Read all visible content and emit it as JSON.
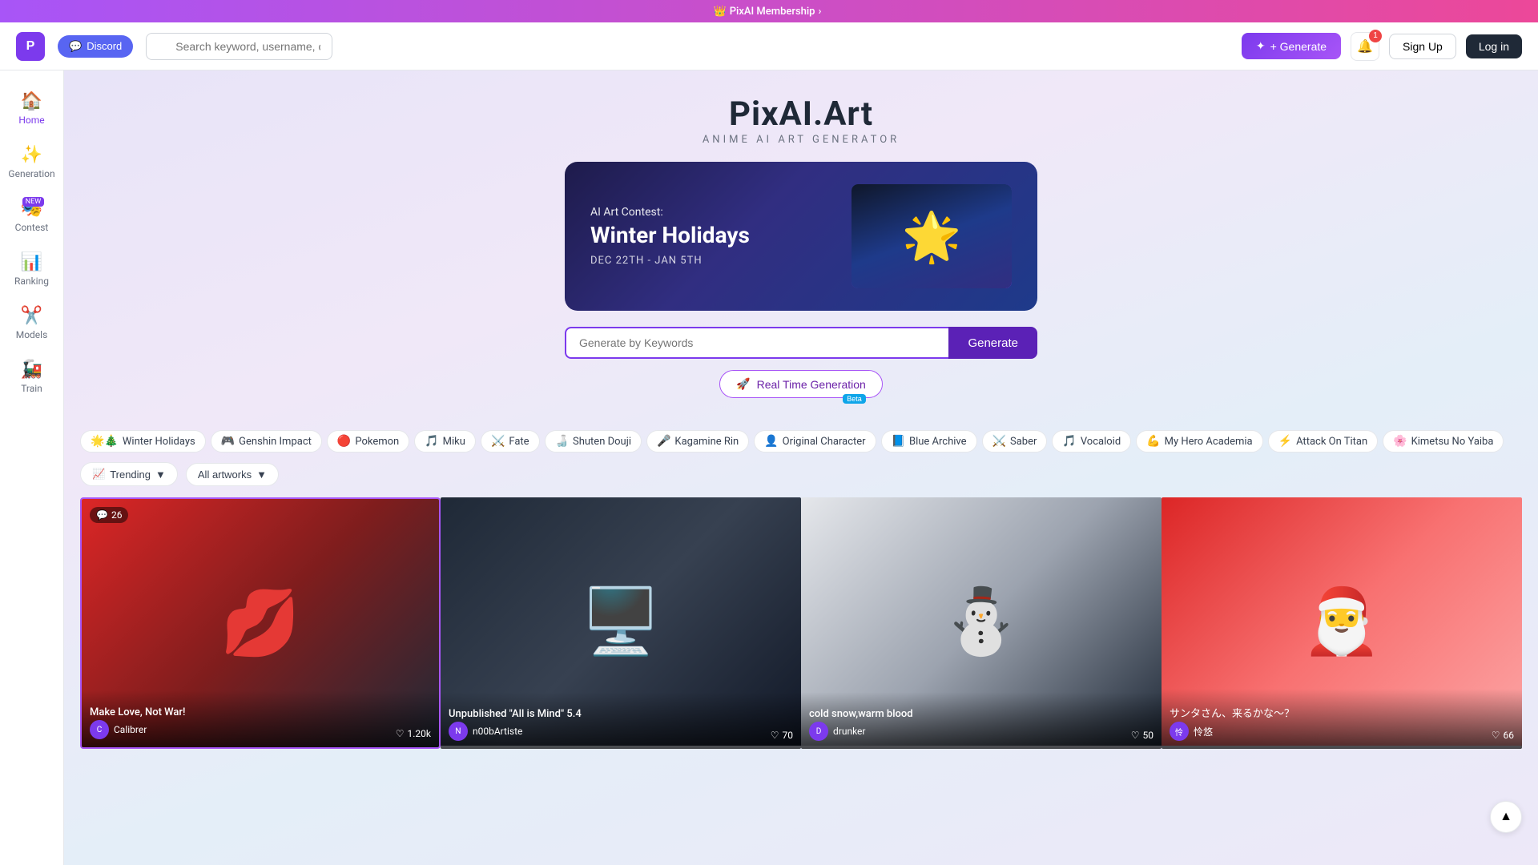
{
  "topBanner": {
    "icon": "👑",
    "text": "PixAI Membership",
    "arrow": "›"
  },
  "header": {
    "logoText": "P",
    "discordLabel": "Discord",
    "discordIcon": "💬",
    "searchPlaceholder": "Search keyword, username, or model name",
    "generateLabel": "+ Generate",
    "notifCount": "1",
    "signUpLabel": "Sign Up",
    "logInLabel": "Log in"
  },
  "sidebar": {
    "items": [
      {
        "id": "home",
        "icon": "🏠",
        "label": "Home",
        "active": true
      },
      {
        "id": "generation",
        "icon": "✨",
        "label": "Generation",
        "active": false
      },
      {
        "id": "contest",
        "icon": "🎭",
        "label": "Contest",
        "active": false,
        "badge": "NEW"
      },
      {
        "id": "ranking",
        "icon": "📊",
        "label": "Ranking",
        "active": false
      },
      {
        "id": "models",
        "icon": "✂️",
        "label": "Models",
        "active": false
      },
      {
        "id": "train",
        "icon": "🚂",
        "label": "Train",
        "active": false
      }
    ]
  },
  "hero": {
    "siteTitle": "PixAI.Art",
    "siteSubtitle": "ANIME AI ART GENERATOR"
  },
  "contestBanner": {
    "label": "AI Art Contest:",
    "title": "Winter Holidays",
    "dateRange": "DEC 22TH - JAN 5TH"
  },
  "generateSection": {
    "placeholder": "Generate by Keywords",
    "buttonLabel": "Generate"
  },
  "realTimeGeneration": {
    "icon": "🚀",
    "label": "Real Time Generation",
    "badge": "Beta"
  },
  "tags": [
    {
      "id": "winter-holidays",
      "emoji": "🌟🎄",
      "label": "Winter Holidays"
    },
    {
      "id": "genshin-impact",
      "emoji": "🎮",
      "label": "Genshin Impact"
    },
    {
      "id": "pokemon",
      "emoji": "🔴",
      "label": "Pokemon"
    },
    {
      "id": "miku",
      "emoji": "🎵",
      "label": "Miku"
    },
    {
      "id": "fate",
      "emoji": "⚔️",
      "label": "Fate"
    },
    {
      "id": "shuten-douji",
      "emoji": "🍶",
      "label": "Shuten Douji"
    },
    {
      "id": "kagamine-rin",
      "emoji": "🎤",
      "label": "Kagamine Rin"
    },
    {
      "id": "original-character",
      "emoji": "👤",
      "label": "Original Character"
    },
    {
      "id": "blue-archive",
      "emoji": "📘",
      "label": "Blue Archive"
    },
    {
      "id": "saber",
      "emoji": "⚔️",
      "label": "Saber"
    },
    {
      "id": "vocaloid",
      "emoji": "🎵",
      "label": "Vocaloid"
    },
    {
      "id": "my-hero-academia",
      "emoji": "💪",
      "label": "My Hero Academia"
    },
    {
      "id": "attack-on-titan",
      "emoji": "⚡",
      "label": "Attack On Titan"
    },
    {
      "id": "kimetsu-no-yaiba",
      "emoji": "🌸",
      "label": "Kimetsu No Yaiba"
    }
  ],
  "filters": {
    "trendingLabel": "Trending",
    "allArtworksLabel": "All artworks"
  },
  "artCards": [
    {
      "id": "card-1",
      "title": "Make Love, Not War!",
      "author": "Calibrer",
      "likes": "1.20k",
      "comments": "26",
      "bgClass": "card-bg-1",
      "emoji": "💋"
    },
    {
      "id": "card-2",
      "title": "Unpublished \"All is Mind\" 5.4",
      "author": "n00bArtiste",
      "likes": "70",
      "comments": "",
      "bgClass": "card-bg-2",
      "emoji": "🖥️"
    },
    {
      "id": "card-3",
      "title": "cold snow,warm blood",
      "author": "drunker",
      "likes": "50",
      "comments": "",
      "bgClass": "card-bg-3",
      "emoji": "⛄"
    },
    {
      "id": "card-4",
      "title": "サンタさん、来るかな～？",
      "author": "怜悠",
      "likes": "66",
      "comments": "",
      "bgClass": "card-bg-4",
      "emoji": "🎅"
    }
  ]
}
